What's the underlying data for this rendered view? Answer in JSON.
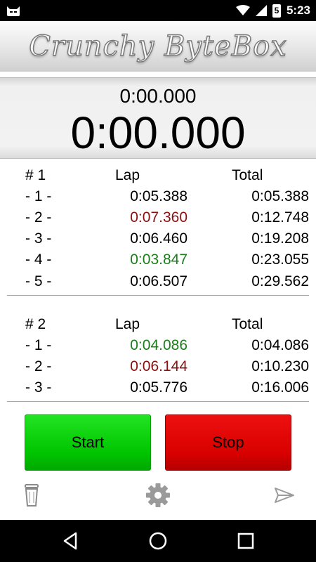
{
  "status_bar": {
    "time": "5:23",
    "battery_level": "5",
    "icons": [
      "cyanogen-bot-icon",
      "wifi-icon",
      "cell-signal-icon",
      "battery-icon"
    ]
  },
  "header": {
    "logo_text": "Crunchy ByteBox"
  },
  "timer": {
    "lap_time": "0:00.000",
    "total_time": "0:00.000"
  },
  "sessions": [
    {
      "label": "# 1",
      "lap_header": "Lap",
      "total_header": "Total",
      "laps": [
        {
          "num": "- 1 -",
          "lap": "0:05.388",
          "total": "0:05.388",
          "mark": "normal"
        },
        {
          "num": "- 2 -",
          "lap": "0:07.360",
          "total": "0:12.748",
          "mark": "slowest"
        },
        {
          "num": "- 3 -",
          "lap": "0:06.460",
          "total": "0:19.208",
          "mark": "normal"
        },
        {
          "num": "- 4 -",
          "lap": "0:03.847",
          "total": "0:23.055",
          "mark": "fastest"
        },
        {
          "num": "- 5 -",
          "lap": "0:06.507",
          "total": "0:29.562",
          "mark": "normal"
        }
      ]
    },
    {
      "label": "# 2",
      "lap_header": "Lap",
      "total_header": "Total",
      "laps": [
        {
          "num": "- 1 -",
          "lap": "0:04.086",
          "total": "0:04.086",
          "mark": "fastest"
        },
        {
          "num": "- 2 -",
          "lap": "0:06.144",
          "total": "0:10.230",
          "mark": "slowest"
        },
        {
          "num": "- 3 -",
          "lap": "0:05.776",
          "total": "0:16.006",
          "mark": "normal"
        }
      ]
    }
  ],
  "buttons": {
    "start": "Start",
    "stop": "Stop"
  },
  "toolbar": {
    "icons": [
      "trash-icon",
      "settings-gear-icon",
      "send-icon"
    ]
  },
  "navigation": {
    "icons": [
      "back-icon",
      "home-icon",
      "recents-icon"
    ]
  },
  "colors": {
    "fastest": "#1a7f1a",
    "slowest": "#8b1010",
    "normal": "#000000",
    "start_button": "#00c400",
    "stop_button": "#d80000"
  }
}
